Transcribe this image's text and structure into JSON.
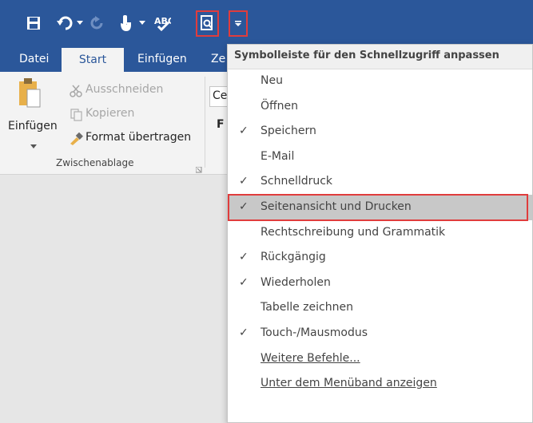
{
  "qat": {
    "save_icon": "save-icon",
    "undo_icon": "undo-icon",
    "redo_icon": "redo-icon",
    "touch_icon": "touch-mode-icon",
    "spell_icon": "spellcheck-icon",
    "preview_icon": "print-preview-icon",
    "customize_icon": "customize-qat-icon"
  },
  "tabs": {
    "file": "Datei",
    "start": "Start",
    "insert": "Einfügen",
    "partial": "Ze"
  },
  "clipboard": {
    "paste": "Einfügen",
    "cut": "Ausschneiden",
    "copy": "Kopieren",
    "format_painter": "Format übertragen",
    "group_label": "Zwischenablage",
    "font_box_partial": "Ce",
    "font_partial": "F"
  },
  "menu": {
    "header": "Symbolleiste für den Schnellzugriff anpassen",
    "check_glyph": "✓",
    "items": [
      {
        "label": "Neu",
        "checked": false
      },
      {
        "label": "Öffnen",
        "checked": false
      },
      {
        "label": "Speichern",
        "checked": true
      },
      {
        "label": "E-Mail",
        "checked": false
      },
      {
        "label": "Schnelldruck",
        "checked": true
      },
      {
        "label": "Seitenansicht und Drucken",
        "checked": true
      },
      {
        "label": "Rechtschreibung und Grammatik",
        "checked": false
      },
      {
        "label": "Rückgängig",
        "checked": true
      },
      {
        "label": "Wiederholen",
        "checked": true
      },
      {
        "label": "Tabelle zeichnen",
        "checked": false
      },
      {
        "label": "Touch-/Mausmodus",
        "checked": true
      },
      {
        "label": "Weitere Befehle...",
        "checked": false
      },
      {
        "label": "Unter dem Menüband anzeigen",
        "checked": false
      }
    ]
  },
  "colors": {
    "ribbon_blue": "#2b579a",
    "highlight_box": "#e03c3c",
    "menu_highlight": "#c8c8c8"
  }
}
